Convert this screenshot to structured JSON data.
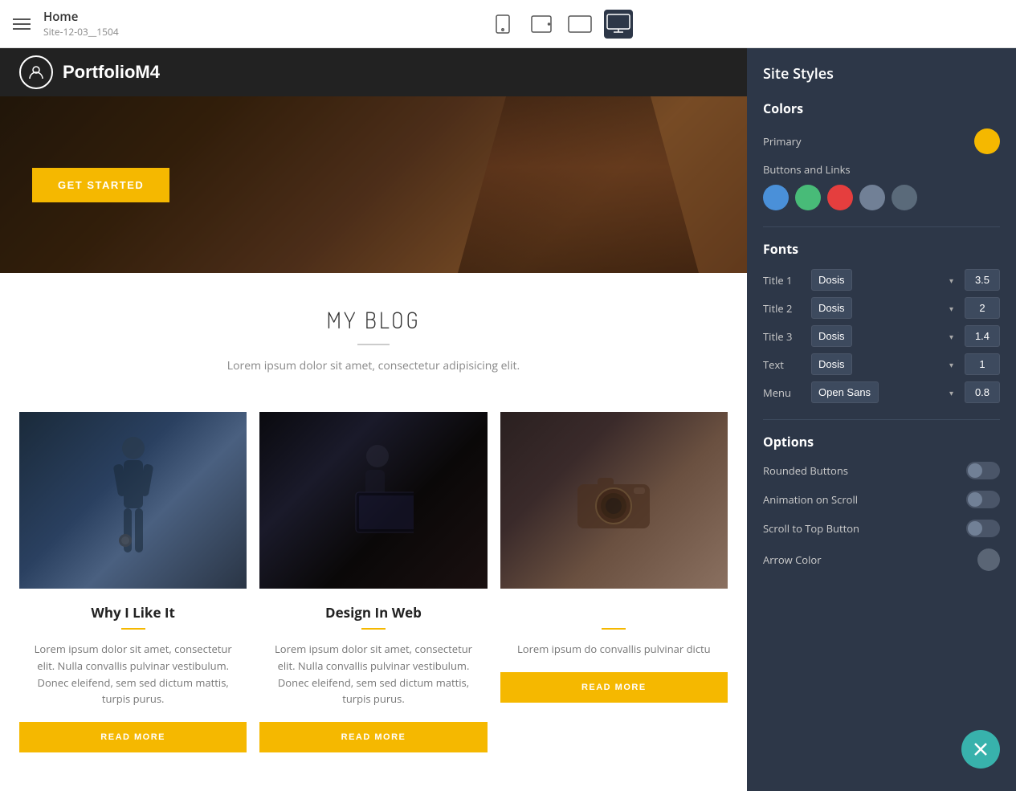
{
  "topbar": {
    "page_name": "Home",
    "site_name": "Site-12-03__1504"
  },
  "devices": [
    {
      "id": "mobile",
      "label": "Mobile"
    },
    {
      "id": "tablet",
      "label": "Tablet"
    },
    {
      "id": "tablet-wide",
      "label": "Tablet Wide"
    },
    {
      "id": "desktop",
      "label": "Desktop",
      "active": true
    }
  ],
  "panel": {
    "title": "Site Styles",
    "colors": {
      "heading": "Colors",
      "primary_label": "Primary",
      "primary_color": "#f5b800",
      "buttons_label": "Buttons and Links",
      "button_colors": [
        "#4a90d9",
        "#48bb78",
        "#e53e3e",
        "#718096",
        "#5a6a7a"
      ]
    },
    "fonts": {
      "heading": "Fonts",
      "rows": [
        {
          "label": "Title 1",
          "font": "Dosis",
          "size": "3.5"
        },
        {
          "label": "Title 2",
          "font": "Dosis",
          "size": "2"
        },
        {
          "label": "Title 3",
          "font": "Dosis",
          "size": "1.4"
        },
        {
          "label": "Text",
          "font": "Dosis",
          "size": "1"
        },
        {
          "label": "Menu",
          "font": "Open Sans",
          "size": "0.8"
        }
      ]
    },
    "options": {
      "heading": "Options",
      "items": [
        {
          "label": "Rounded Buttons",
          "on": false
        },
        {
          "label": "Animation on Scroll",
          "on": false
        },
        {
          "label": "Scroll to Top Button",
          "on": false
        },
        {
          "label": "Arrow Color",
          "type": "color"
        }
      ]
    }
  },
  "site": {
    "logo_text": "PortfolioM4",
    "hero_btn": "GET STARTED",
    "blog": {
      "title": "MY BLOG",
      "subtitle": "Lorem ipsum dolor sit amet, consectetur adipisicing elit.",
      "cards": [
        {
          "title": "Why I Like It",
          "text": "Lorem ipsum dolor sit amet, consectetur elit. Nulla convallis pulvinar vestibulum. Donec eleifend, sem sed dictum mattis, turpis purus.",
          "btn": "READ MORE"
        },
        {
          "title": "Design In Web",
          "text": "Lorem ipsum dolor sit amet, consectetur elit. Nulla convallis pulvinar vestibulum. Donec eleifend, sem sed dictum mattis, turpis purus.",
          "btn": "READ MORE"
        },
        {
          "title": "",
          "text": "Lorem ipsum do convallis pulvinar dictu",
          "btn": "READ MORE"
        }
      ]
    }
  },
  "fab": {
    "icon": "close-icon"
  }
}
